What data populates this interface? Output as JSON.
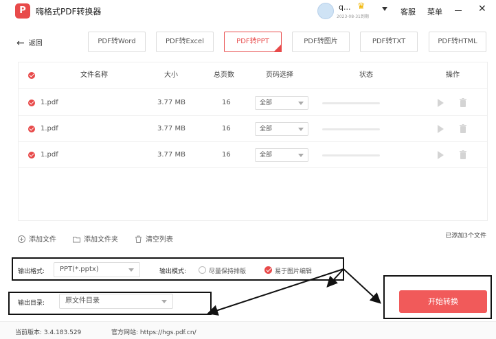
{
  "app": {
    "logo": "P",
    "title": "嗨格式PDF转换器",
    "user_name": "q...",
    "user_date": "2023-08-31到期",
    "service_label": "客服",
    "menu_label": "菜单",
    "minimize_glyph": "—",
    "close_glyph": "✕"
  },
  "nav": {
    "back_label": "返回",
    "tabs": [
      {
        "label": "PDF转Word",
        "active": false
      },
      {
        "label": "PDF转Excel",
        "active": false
      },
      {
        "label": "PDF转PPT",
        "active": true
      },
      {
        "label": "PDF转图片",
        "active": false
      },
      {
        "label": "PDF转TXT",
        "active": false
      },
      {
        "label": "PDF转HTML",
        "active": false
      }
    ]
  },
  "table": {
    "headers": {
      "name": "文件名称",
      "size": "大小",
      "pages": "总页数",
      "page_select": "页码选择",
      "status": "状态",
      "actions": "操作"
    },
    "rows": [
      {
        "name": "1.pdf",
        "size": "3.77 MB",
        "pages": "16",
        "page_select": "全部",
        "progress": 0
      },
      {
        "name": "1.pdf",
        "size": "3.77 MB",
        "pages": "16",
        "page_select": "全部",
        "progress": 0
      },
      {
        "name": "1.pdf",
        "size": "3.77 MB",
        "pages": "16",
        "page_select": "全部",
        "progress": 0
      }
    ]
  },
  "actions": {
    "add_file": "添加文件",
    "add_folder": "添加文件夹",
    "clear_list": "清空列表",
    "added_count": "已添加3个文件"
  },
  "output": {
    "format_label": "输出格式:",
    "format_value": "PPT(*.pptx)",
    "mode_label": "输出模式:",
    "mode_options": [
      {
        "label": "尽量保持排版",
        "selected": false
      },
      {
        "label": "易于图片编辑",
        "selected": true
      }
    ],
    "dir_label": "输出目录:",
    "dir_value": "原文件目录",
    "start_label": "开始转换"
  },
  "footer": {
    "version": "当前版本: 3.4.183.529",
    "website": "官方网站: https://hgs.pdf.cn/"
  },
  "colors": {
    "accent": "#e84a4a",
    "button": "#f15a5a"
  }
}
